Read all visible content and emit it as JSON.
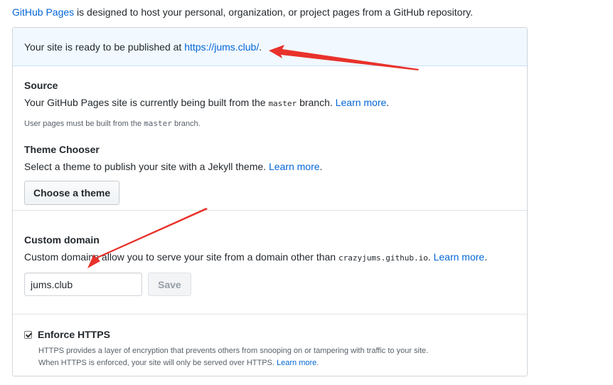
{
  "intro": {
    "link": "GitHub Pages",
    "text": " is designed to host your personal, organization, or project pages from a GitHub repository."
  },
  "flash": {
    "text": "Your site is ready to be published at ",
    "url": "https://jums.club/",
    "end": "."
  },
  "source": {
    "heading": "Source",
    "text_before": "Your GitHub Pages site is currently being built from the ",
    "branch": "master",
    "text_after": " branch. ",
    "learn_more": "Learn more",
    "period": ".",
    "note_before": "User pages must be built from the ",
    "note_branch": "master",
    "note_after": " branch."
  },
  "theme": {
    "heading": "Theme Chooser",
    "text": "Select a theme to publish your site with a Jekyll theme. ",
    "learn_more": "Learn more",
    "period": ".",
    "button": "Choose a theme"
  },
  "custom_domain": {
    "heading": "Custom domain",
    "text": "Custom domains allow you to serve your site from a domain other than ",
    "domain": "crazyjums.github.io",
    "text_after": ". ",
    "learn_more": "Learn more",
    "period": ".",
    "input_value": "jums.club",
    "save_button": "Save"
  },
  "https": {
    "label": "Enforce HTTPS",
    "checked": true,
    "desc1": "HTTPS provides a layer of encryption that prevents others from snooping on or tampering with traffic to your site.",
    "desc2": "When HTTPS is enforced, your site will only be served over HTTPS. ",
    "learn_more": "Learn more",
    "period": "."
  },
  "colors": {
    "link": "#0366d6",
    "flash_bg": "#f1f8ff",
    "annotation_arrow": "#e8322b"
  }
}
